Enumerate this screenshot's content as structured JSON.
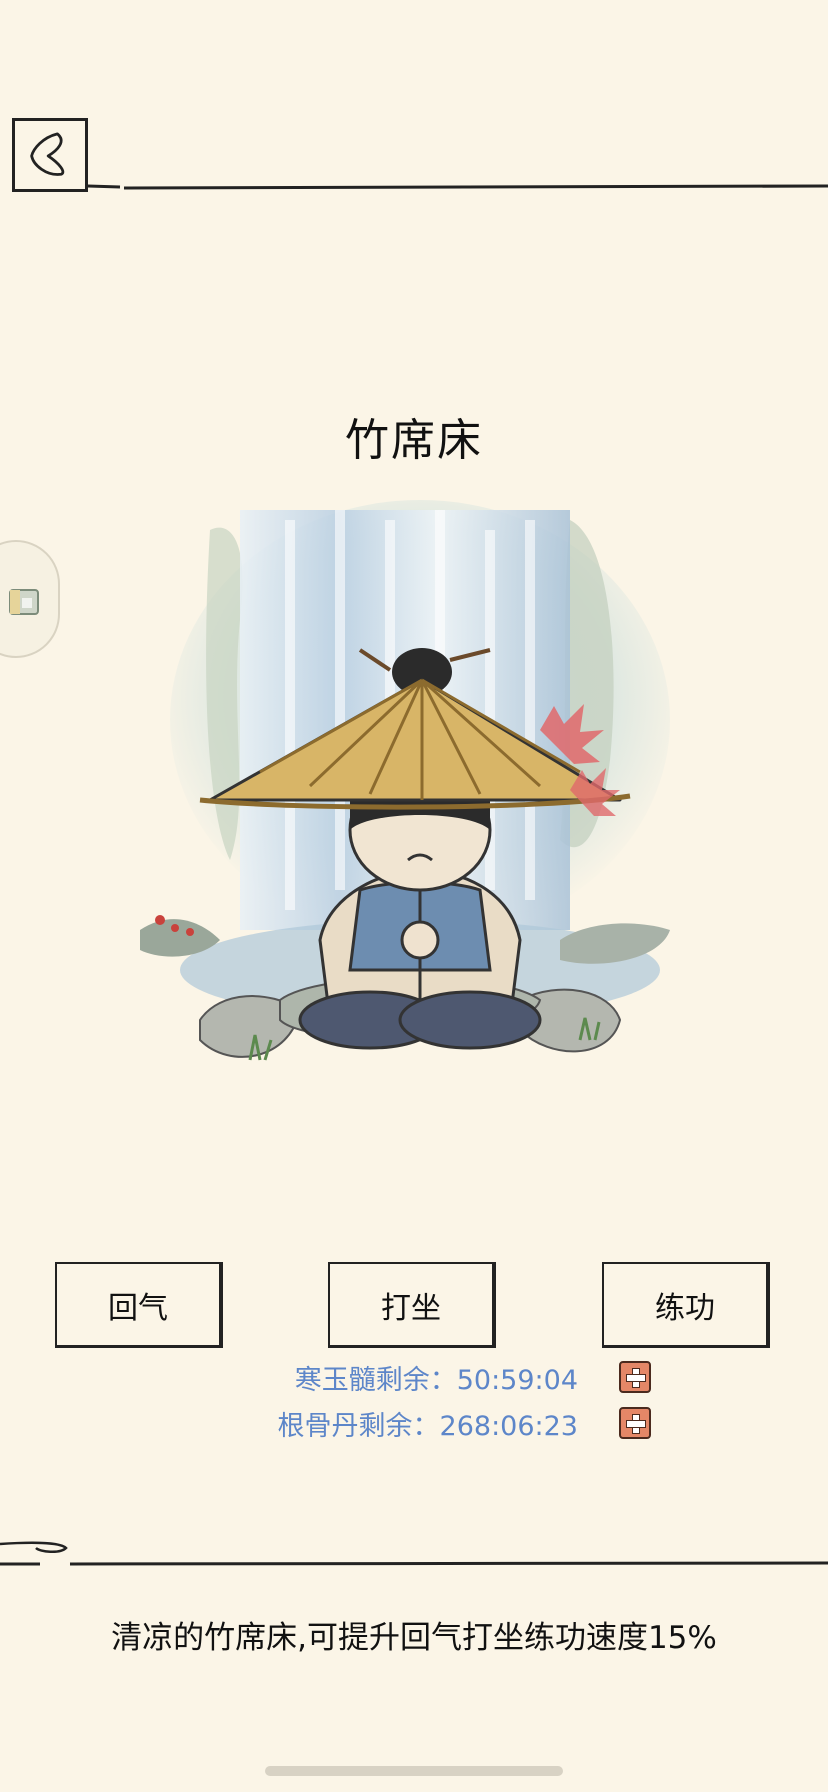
{
  "header": {
    "back_icon": "back-arrow-icon"
  },
  "side_tab": {
    "icon": "gift-box-icon"
  },
  "item": {
    "title": "竹席床",
    "description": "清凉的竹席床,可提升回气打坐练功速度15%"
  },
  "actions": [
    {
      "label": "回气"
    },
    {
      "label": "打坐"
    },
    {
      "label": "练功"
    }
  ],
  "resources": [
    {
      "text": "寒玉髓剩余：50:59:04",
      "add_icon": "plus-icon"
    },
    {
      "text": "根骨丹剩余：268:06:23",
      "add_icon": "plus-icon"
    }
  ],
  "colors": {
    "background": "#fbf5e7",
    "resource_text": "#5d86c9",
    "plus_button": "#e48767"
  }
}
